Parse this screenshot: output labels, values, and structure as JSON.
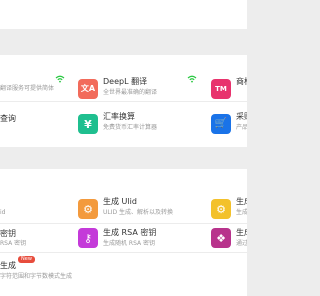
{
  "section1": {
    "row1": {
      "left_desc": "翻译服务可提供简体",
      "middle": {
        "title": "DeepL 翻译",
        "desc": "全世界最准确的翻译",
        "icon_glyph": "文A",
        "icon": "translate-icon"
      },
      "right": {
        "title": "商标",
        "icon_glyph": "TM",
        "icon": "trademark-icon"
      }
    },
    "row2": {
      "left_title": "查询",
      "middle": {
        "title": "汇率换算",
        "desc": "免费货币汇率计算器",
        "icon_glyph": "¥",
        "icon": "currency-icon"
      },
      "right": {
        "title": "采购",
        "desc": "产品",
        "icon_glyph": "🛒",
        "icon": "cart-icon"
      }
    }
  },
  "section2": {
    "row1": {
      "left_desc": "id",
      "middle": {
        "title": "生成 Ulid",
        "desc": "ULID 生成、解析以及转换",
        "icon_glyph": "⚙",
        "icon": "ulid-icon"
      },
      "right": {
        "title": "生成",
        "desc": "生成",
        "icon_glyph": "⚙",
        "icon": "generator-icon"
      }
    },
    "row2": {
      "left_title": "密钥",
      "left_desc": "RSA 密钥",
      "middle": {
        "title": "生成 RSA 密钥",
        "desc": "生成随机 RSA 密钥",
        "icon_glyph": "⚷",
        "icon": "key-icon"
      },
      "right": {
        "title": "生成",
        "desc": "通过",
        "icon_glyph": "❖",
        "icon": "pattern-icon"
      }
    },
    "row3": {
      "left_title": "生成",
      "left_badge": "New",
      "left_desc": "字符范围和字节数模式生成"
    }
  },
  "colors": {
    "deepl": "#f26b5b",
    "trademark": "#e8336d",
    "currency": "#1fbf8f",
    "cart": "#1a73e8",
    "ulid": "#f39a3d",
    "generator": "#f3c12b",
    "rsa": "#c43ad9",
    "pattern": "#b8338c",
    "wifi": "#28c840"
  }
}
